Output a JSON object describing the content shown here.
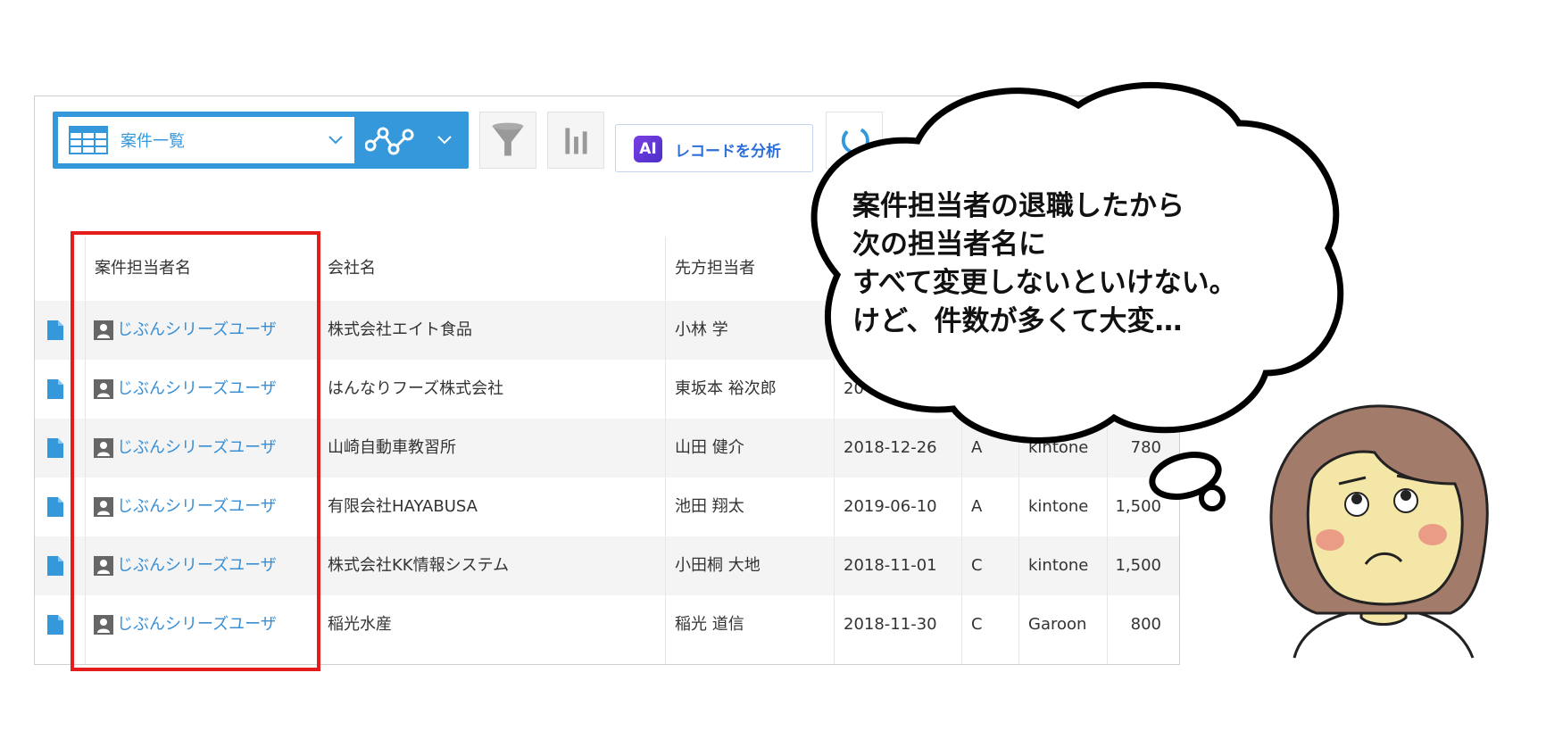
{
  "toolbar": {
    "view_name": "案件一覧",
    "ai_badge": "AI",
    "ai_button_label": "レコードを分析"
  },
  "table": {
    "headers": [
      "案件担当者名",
      "会社名",
      "先方担当者"
    ],
    "rows": [
      {
        "owner": "じぶんシリーズユーザ",
        "company": "株式会社エイト食品",
        "contact": "小林 学",
        "date": "",
        "rank": "",
        "product": "",
        "amount": ""
      },
      {
        "owner": "じぶんシリーズユーザ",
        "company": "はんなりフーズ株式会社",
        "contact": "東坂本 裕次郎",
        "date": "20",
        "rank": "",
        "product": "",
        "amount": ""
      },
      {
        "owner": "じぶんシリーズユーザ",
        "company": "山崎自動車教習所",
        "contact": "山田 健介",
        "date": "2018-12-26",
        "rank": "A",
        "product": "kintone",
        "amount": "780"
      },
      {
        "owner": "じぶんシリーズユーザ",
        "company": "有限会社HAYABUSA",
        "contact": "池田 翔太",
        "date": "2019-06-10",
        "rank": "A",
        "product": "kintone",
        "amount": "1,500"
      },
      {
        "owner": "じぶんシリーズユーザ",
        "company": "株式会社KK情報システム",
        "contact": "小田桐 大地",
        "date": "2018-11-01",
        "rank": "C",
        "product": "kintone",
        "amount": "1,500"
      },
      {
        "owner": "じぶんシリーズユーザ",
        "company": "稲光水産",
        "contact": "稲光 道信",
        "date": "2018-11-30",
        "rank": "C",
        "product": "Garoon",
        "amount": "800"
      }
    ]
  },
  "bubble": {
    "lines": [
      "案件担当者の退職したから",
      "次の担当者名に",
      "すべて変更しないといけない。",
      "けど、件数が多くて大変…"
    ]
  },
  "colors": {
    "accent": "#3498db",
    "link": "#3a8fd4",
    "highlight": "#e51c1c"
  }
}
